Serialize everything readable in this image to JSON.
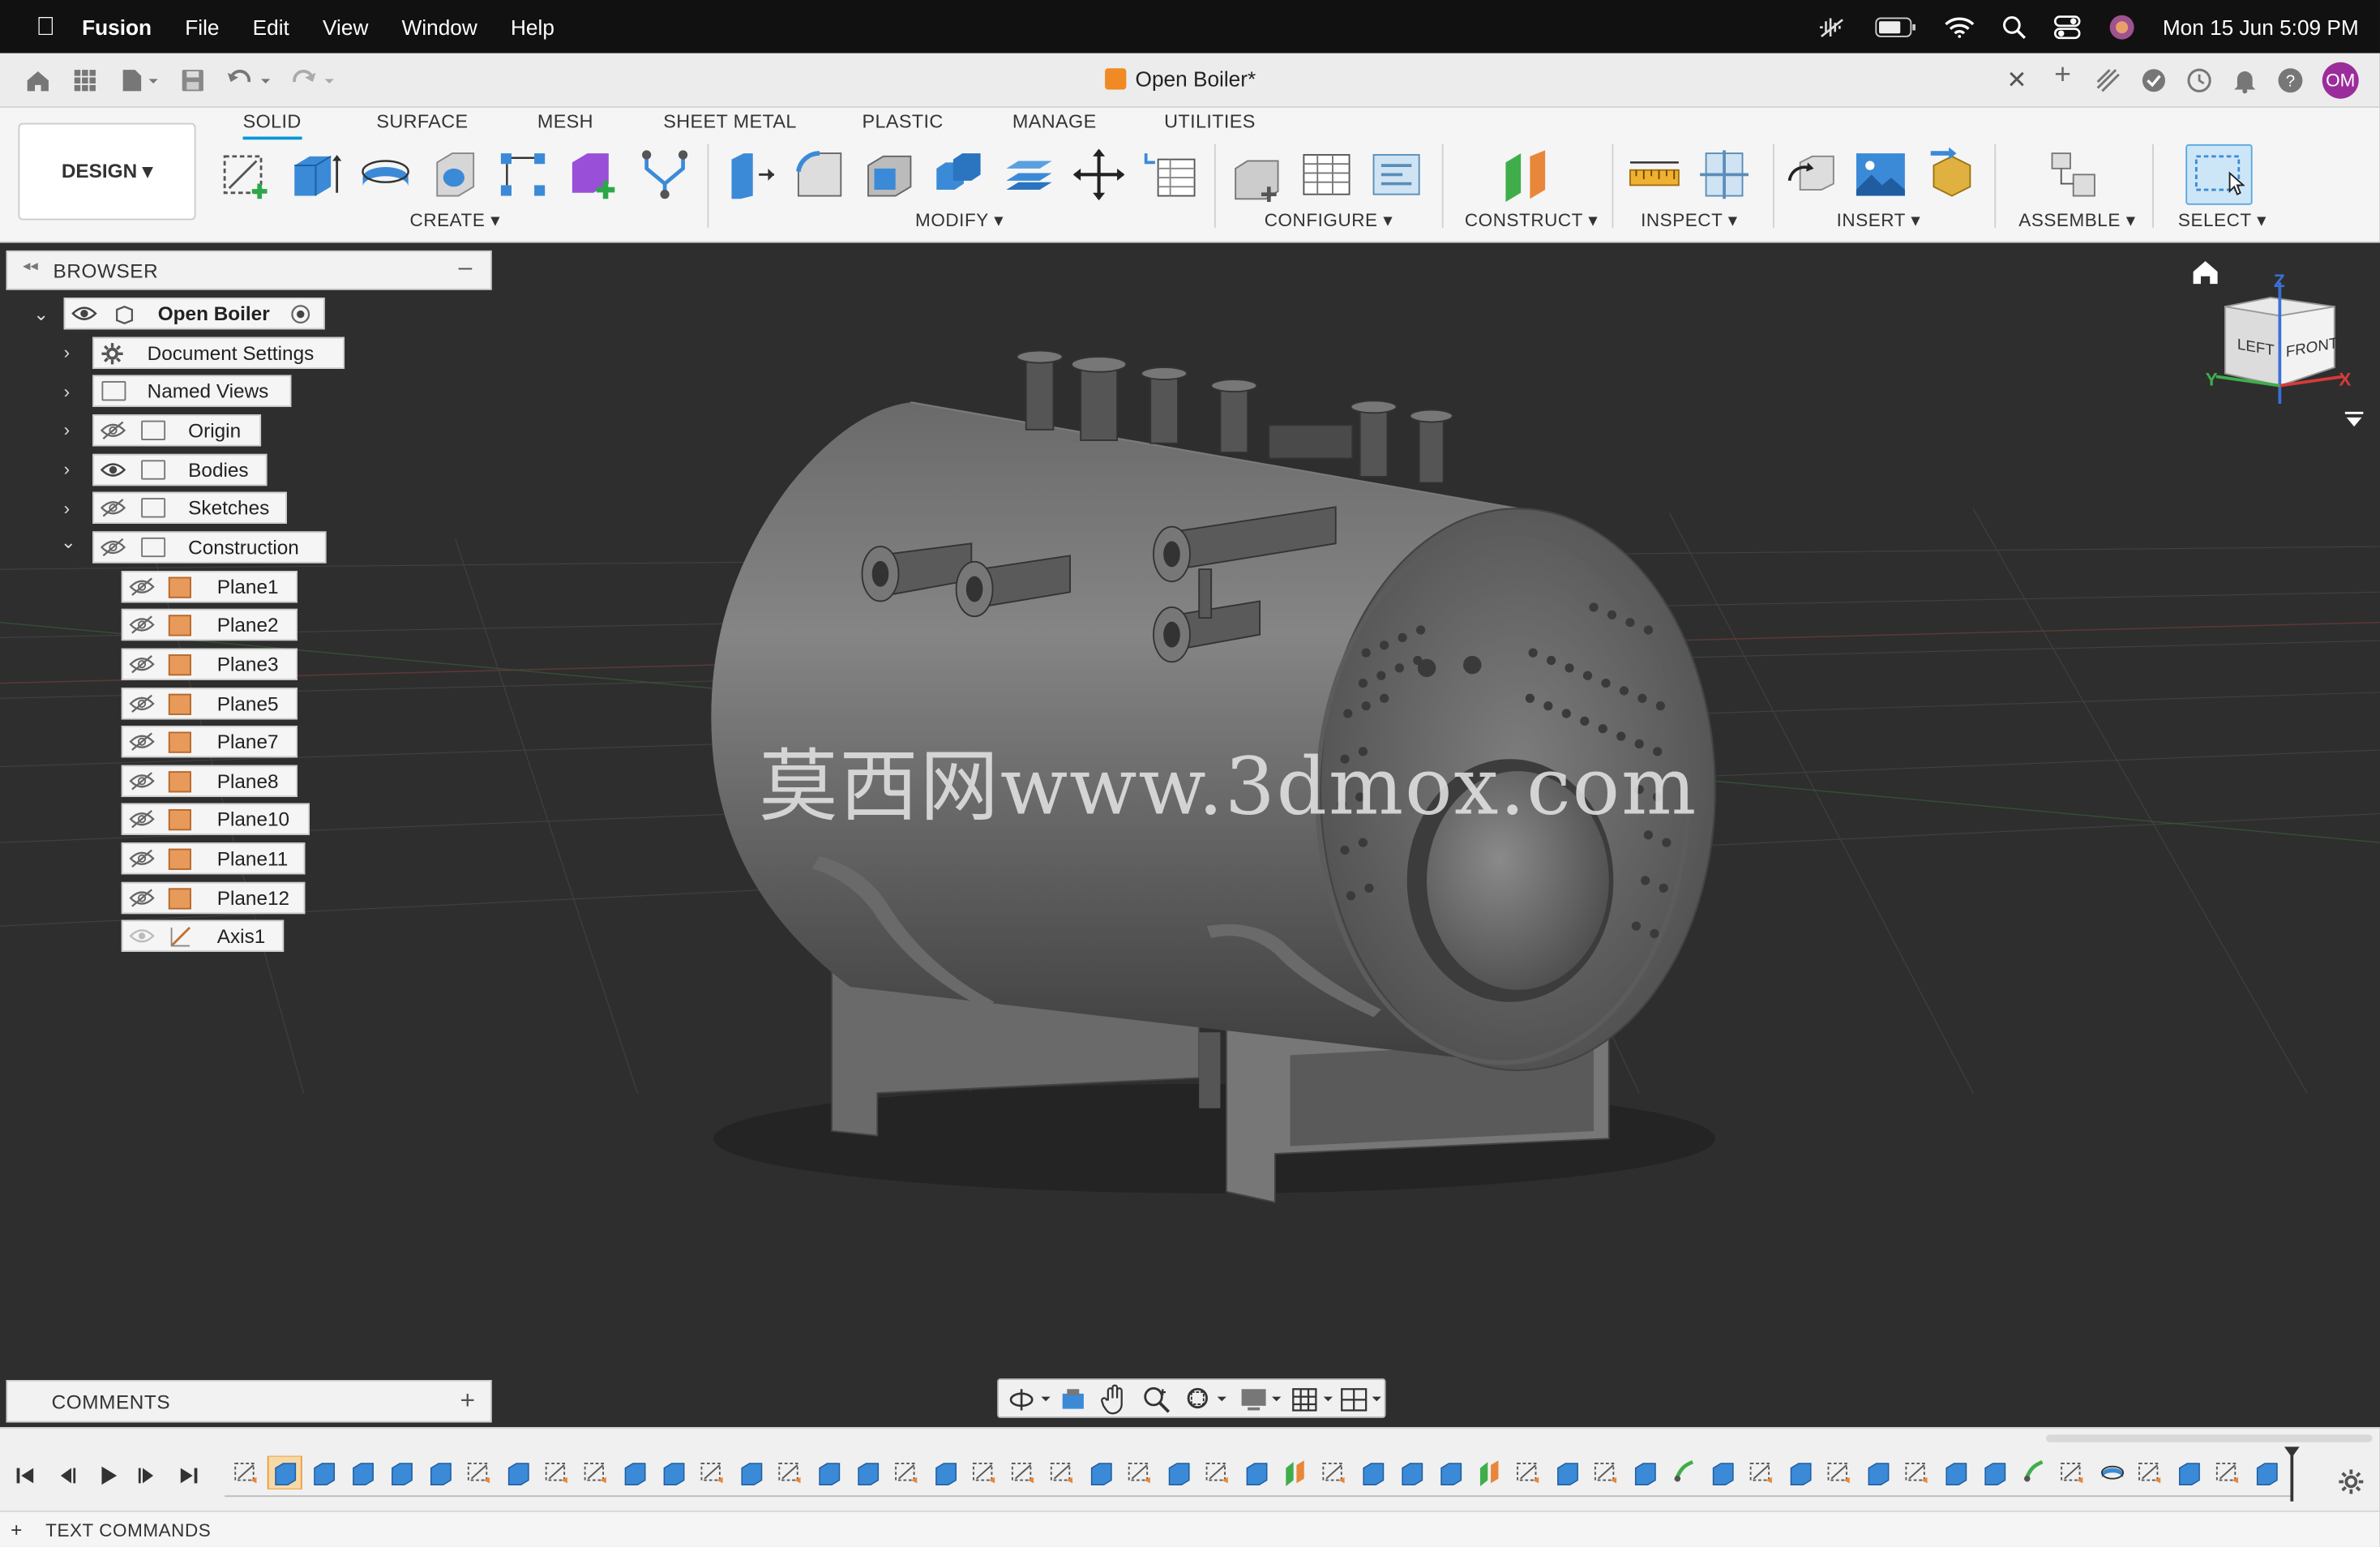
{
  "menubar": {
    "app_name": "Fusion",
    "items": [
      "File",
      "Edit",
      "View",
      "Window",
      "Help"
    ],
    "clock": "Mon 15 Jun  5:09 PM"
  },
  "titlebar": {
    "document_title": "Open Boiler*",
    "avatar_initials": "OM"
  },
  "ribbon": {
    "workspace": "DESIGN",
    "tabs": [
      "SOLID",
      "SURFACE",
      "MESH",
      "SHEET METAL",
      "PLASTIC",
      "MANAGE",
      "UTILITIES"
    ],
    "active_tab": "SOLID",
    "groups": [
      "CREATE",
      "MODIFY",
      "CONFIGURE",
      "CONSTRUCT",
      "INSPECT",
      "INSERT",
      "ASSEMBLE",
      "SELECT"
    ]
  },
  "browser": {
    "title": "BROWSER",
    "root": "Open Boiler",
    "nodes": [
      "Document Settings",
      "Named Views",
      "Origin",
      "Bodies",
      "Sketches",
      "Construction"
    ],
    "construction_items": [
      "Plane1",
      "Plane2",
      "Plane3",
      "Plane5",
      "Plane7",
      "Plane8",
      "Plane10",
      "Plane11",
      "Plane12",
      "Axis1"
    ]
  },
  "viewcube": {
    "left_label": "LEFT",
    "front_label": "FRONT",
    "axis_z": "Z",
    "axis_x": "X",
    "axis_y": "Y"
  },
  "watermark": "莫西网www.3dmox.com",
  "comments": {
    "title": "COMMENTS"
  },
  "text_commands": {
    "title": "TEXT COMMANDS"
  },
  "colors": {
    "accent": "#0696d7",
    "plane_icon": "#e89a5a",
    "document_icon": "#f08a24",
    "avatar": "#9b2c9b"
  }
}
